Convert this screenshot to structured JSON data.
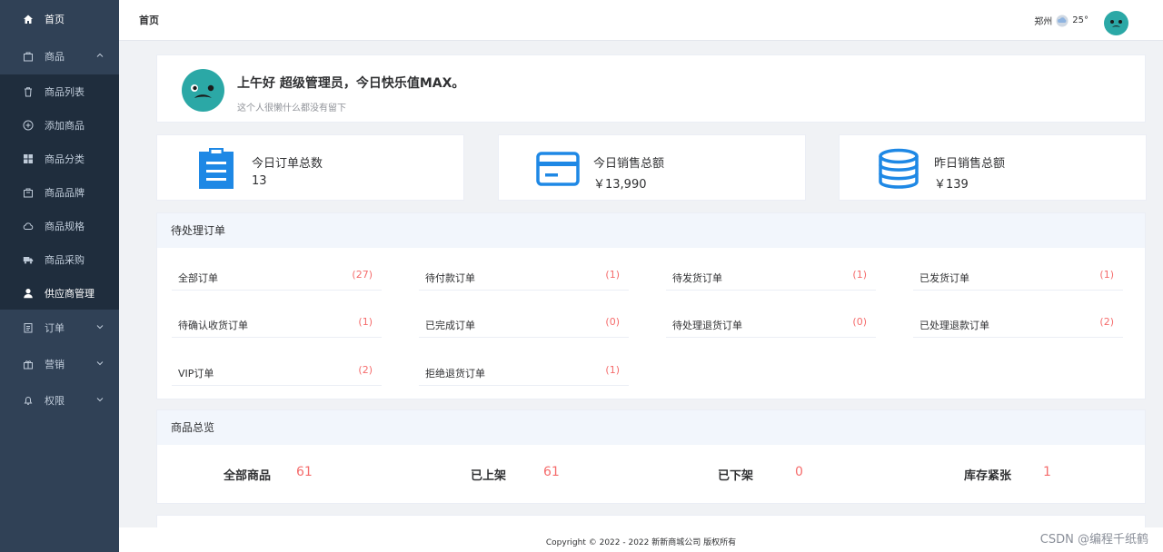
{
  "sidebar": {
    "home": "首页",
    "goods": "商品",
    "goods_items": [
      "商品列表",
      "添加商品",
      "商品分类",
      "商品品牌",
      "商品规格",
      "商品采购",
      "供应商管理"
    ],
    "orders": "订单",
    "marketing": "营销",
    "permissions": "权限"
  },
  "topbar": {
    "breadcrumb": "首页",
    "city": "郑州",
    "temp": "25°",
    "weather_icon": "cloud-icon"
  },
  "welcome": {
    "greeting": "上午好 超级管理员，今日快乐值MAX。",
    "signature": "这个人很懒什么都没有留下"
  },
  "stats": [
    {
      "label": "今日订单总数",
      "value": "13",
      "icon": "clipboard-icon"
    },
    {
      "label": "今日销售总额",
      "value": "￥13,990",
      "icon": "card-icon"
    },
    {
      "label": "昨日销售总额",
      "value": "￥139",
      "icon": "database-icon"
    }
  ],
  "orders": {
    "title": "待处理订单",
    "items": [
      {
        "label": "全部订单",
        "count": "(27)"
      },
      {
        "label": "待付款订单",
        "count": "(1)"
      },
      {
        "label": "待发货订单",
        "count": "(1)"
      },
      {
        "label": "已发货订单",
        "count": "(1)"
      },
      {
        "label": "待确认收货订单",
        "count": "(1)"
      },
      {
        "label": "已完成订单",
        "count": "(0)"
      },
      {
        "label": "待处理退货订单",
        "count": "(0)"
      },
      {
        "label": "已处理退款订单",
        "count": "(2)"
      },
      {
        "label": "VIP订单",
        "count": "(2)"
      },
      {
        "label": "拒绝退货订单",
        "count": "(1)"
      }
    ]
  },
  "goods": {
    "title": "商品总览",
    "items": [
      {
        "label": "全部商品",
        "value": "61"
      },
      {
        "label": "已上架",
        "value": "61"
      },
      {
        "label": "已下架",
        "value": "0"
      },
      {
        "label": "库存紧张",
        "value": "1"
      }
    ]
  },
  "footer": "Copyright © 2022 - 2022  新新商城公司 版权所有",
  "watermark": "CSDN @编程千纸鹤",
  "colors": {
    "accent": "#1e88e5",
    "danger": "#f56c6c",
    "sidebar": "#304156"
  }
}
